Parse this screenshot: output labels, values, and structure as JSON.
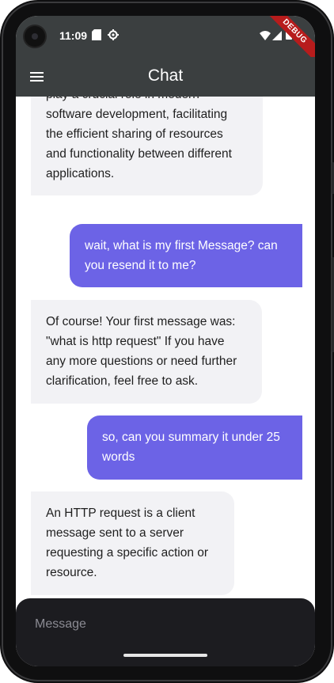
{
  "status_bar": {
    "time": "11:09",
    "icons": [
      "sd-card-icon",
      "settings-gear-icon",
      "wifi-icon",
      "signal-icon",
      "battery-icon"
    ],
    "debug_banner": "DEBUG"
  },
  "app_bar": {
    "menu_icon": "hamburger-menu-icon",
    "title": "Chat"
  },
  "messages": [
    {
      "role": "assistant",
      "lines": [
        "play a crucial role in modern",
        "software development, facilitating",
        "the efficient sharing of resources",
        "and functionality between different",
        "applications."
      ]
    },
    {
      "role": "user",
      "lines": [
        "wait, what is my first Message? can",
        "you resend it to me?"
      ]
    },
    {
      "role": "assistant",
      "lines": [
        "Of course! Your first message was:",
        "\"what is http request\" If you have",
        "any more questions or need further",
        "clarification, feel free to ask."
      ]
    },
    {
      "role": "user",
      "lines": [
        "so, can you summary it under 25",
        "words"
      ]
    },
    {
      "role": "assistant",
      "lines": [
        "An HTTP request is a client",
        "message sent to a server",
        "requesting a specific action or",
        "resource."
      ]
    }
  ],
  "composer": {
    "placeholder": "Message",
    "value": ""
  },
  "colors": {
    "app_bar": "#3b3f40",
    "user_bubble": "#6c63e6",
    "assistant_bubble": "#f2f2f5",
    "composer": "#1c1c20",
    "debug_ribbon": "#b71c1c"
  }
}
